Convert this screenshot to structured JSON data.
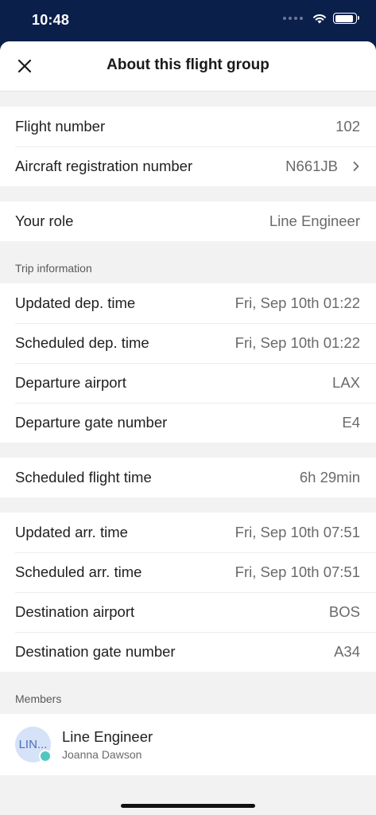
{
  "status_bar": {
    "time": "10:48"
  },
  "header": {
    "title": "About this flight group"
  },
  "flight": {
    "rows": [
      {
        "label": "Flight number",
        "value": "102"
      },
      {
        "label": "Aircraft registration number",
        "value": "N661JB"
      }
    ]
  },
  "role": {
    "label": "Your role",
    "value": "Line Engineer"
  },
  "trip": {
    "header": "Trip information",
    "departure": [
      {
        "label": "Updated dep. time",
        "value": "Fri, Sep 10th 01:22"
      },
      {
        "label": "Scheduled dep. time",
        "value": "Fri, Sep 10th 01:22"
      },
      {
        "label": "Departure airport",
        "value": "LAX"
      },
      {
        "label": "Departure gate number",
        "value": "E4"
      }
    ],
    "flight_time": {
      "label": "Scheduled flight time",
      "value": "6h 29min"
    },
    "arrival": [
      {
        "label": "Updated arr. time",
        "value": "Fri, Sep 10th 07:51"
      },
      {
        "label": "Scheduled arr. time",
        "value": "Fri, Sep 10th 07:51"
      },
      {
        "label": "Destination airport",
        "value": "BOS"
      },
      {
        "label": "Destination gate number",
        "value": "A34"
      }
    ]
  },
  "members": {
    "header": "Members",
    "items": [
      {
        "initials": "LIN...",
        "name": "Line Engineer",
        "subtitle": "Joanna Dawson"
      }
    ]
  },
  "colors": {
    "status_bar_bg": "#0b1f4b",
    "presence": "#52c6c0",
    "avatar_bg": "#d6e2f8"
  }
}
